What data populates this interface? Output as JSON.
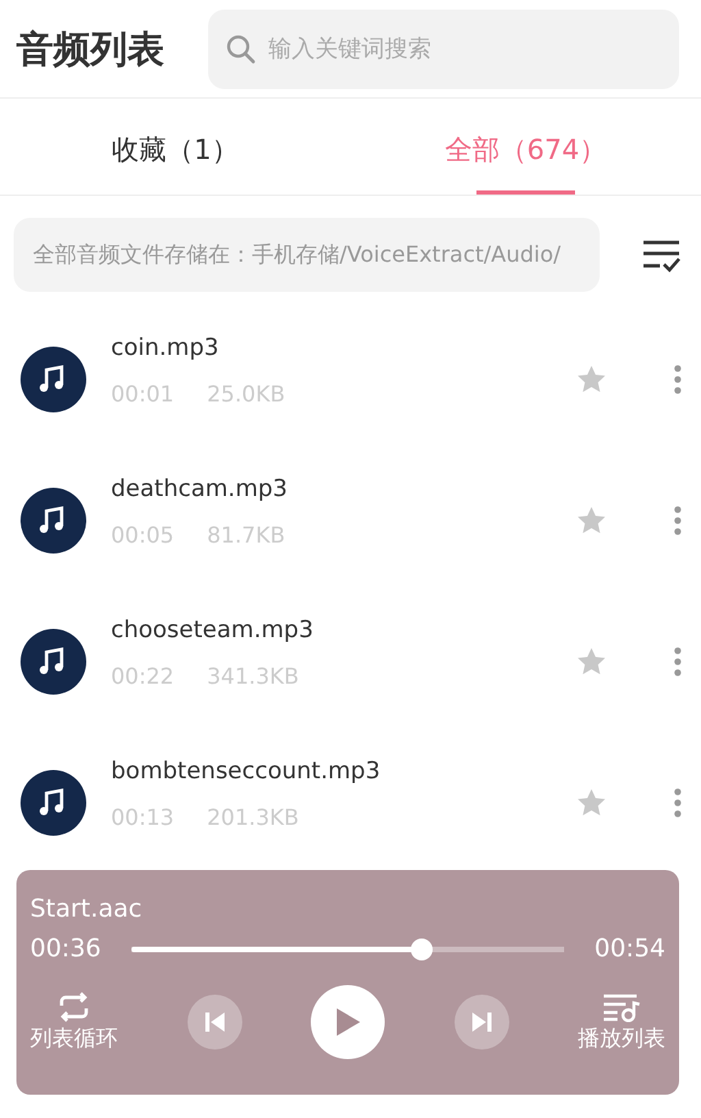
{
  "header": {
    "title": "音频列表",
    "search": {
      "placeholder": "输入关键词搜索"
    }
  },
  "tabs": [
    {
      "label": "收藏（1）",
      "selected": false
    },
    {
      "label": "全部（674）",
      "selected": true
    }
  ],
  "storage_path": "全部音频文件存储在：手机存储/VoiceExtract/Audio/",
  "files": [
    {
      "name": "coin.mp3",
      "duration": "00:01",
      "size": "25.0KB",
      "favorite": false
    },
    {
      "name": "deathcam.mp3",
      "duration": "00:05",
      "size": "81.7KB",
      "favorite": false
    },
    {
      "name": "chooseteam.mp3",
      "duration": "00:22",
      "size": "341.3KB",
      "favorite": false
    },
    {
      "name": "bombtenseccount.mp3",
      "duration": "00:13",
      "size": "201.3KB",
      "favorite": false
    }
  ],
  "player": {
    "title": "Start.aac",
    "current": "00:36",
    "total": "00:54",
    "level": 0.67,
    "playing": false,
    "mode_label": "列表循环",
    "playlist_label": "播放列表"
  }
}
